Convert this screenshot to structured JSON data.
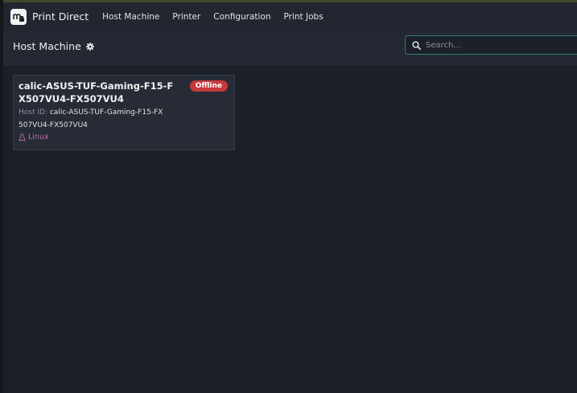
{
  "app": {
    "brand_name": "Print Direct",
    "logo_icon": "print-direct-logo-icon"
  },
  "nav": {
    "items": [
      {
        "label": "Host Machine"
      },
      {
        "label": "Printer"
      },
      {
        "label": "Configuration"
      },
      {
        "label": "Print Jobs"
      }
    ]
  },
  "subheader": {
    "title": "Host Machine",
    "settings_icon": "gear-icon"
  },
  "search": {
    "placeholder": "Search...",
    "value": "",
    "icon": "search-icon"
  },
  "hosts": [
    {
      "hostname": "calic-ASUS-TUF-Gaming-F15-FX507VU4-FX507VU4",
      "status": "Offline",
      "host_id_label": "Host ID:",
      "host_id": "calic-ASUS-TUF-Gaming-F15-FX507VU4-FX507VU4",
      "os": "Linux",
      "os_icon": "linux-icon"
    }
  ],
  "colors": {
    "background": "#1b1f27",
    "navbar": "#212630",
    "subheader": "#232832",
    "card": "#262b35",
    "status_offline": "#c6393b",
    "os_accent": "#c06bb4",
    "search_border": "#2f7d7d"
  }
}
